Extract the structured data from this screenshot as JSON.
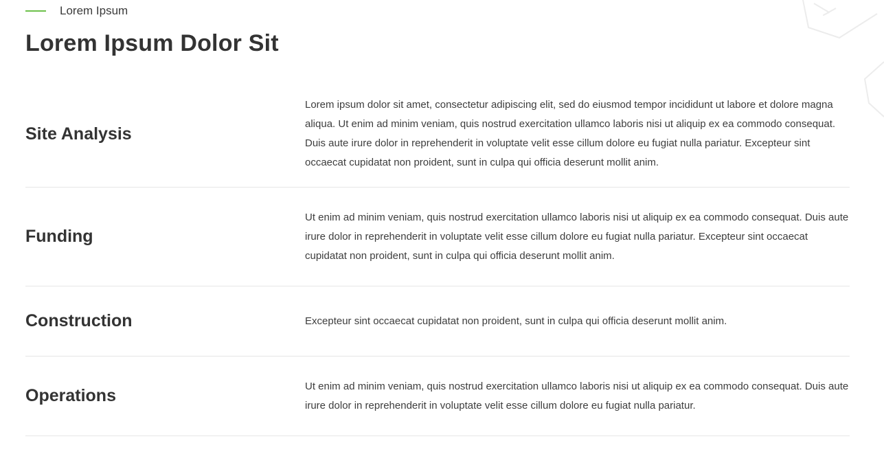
{
  "accent_color": "#6cc04a",
  "eyebrow": {
    "label": "Lorem Ipsum"
  },
  "title": "Lorem Ipsum Dolor Sit",
  "rows": [
    {
      "name": "Site Analysis",
      "description": "Lorem ipsum dolor sit amet, consectetur adipiscing elit, sed do eiusmod tempor incididunt ut labore et dolore magna aliqua. Ut enim ad minim veniam, quis nostrud exercitation ullamco laboris nisi ut aliquip ex ea commodo consequat. Duis aute irure dolor in reprehenderit in voluptate velit esse cillum dolore eu fugiat nulla pariatur. Excepteur sint occaecat cupidatat non proident, sunt in culpa qui officia deserunt mollit anim."
    },
    {
      "name": "Funding",
      "description": "Ut enim ad minim veniam, quis nostrud exercitation ullamco laboris nisi ut aliquip ex ea commodo consequat. Duis aute irure dolor in reprehenderit in voluptate velit esse cillum dolore eu fugiat nulla pariatur. Excepteur sint occaecat cupidatat non proident, sunt in culpa qui officia deserunt mollit anim."
    },
    {
      "name": "Construction",
      "description": "Excepteur sint occaecat cupidatat non proident, sunt in culpa qui officia deserunt mollit anim."
    },
    {
      "name": "Operations",
      "description": "Ut enim ad minim veniam, quis nostrud exercitation ullamco laboris nisi ut aliquip ex ea commodo consequat. Duis aute irure dolor in reprehenderit in voluptate velit esse cillum dolore eu fugiat nulla pariatur."
    }
  ]
}
